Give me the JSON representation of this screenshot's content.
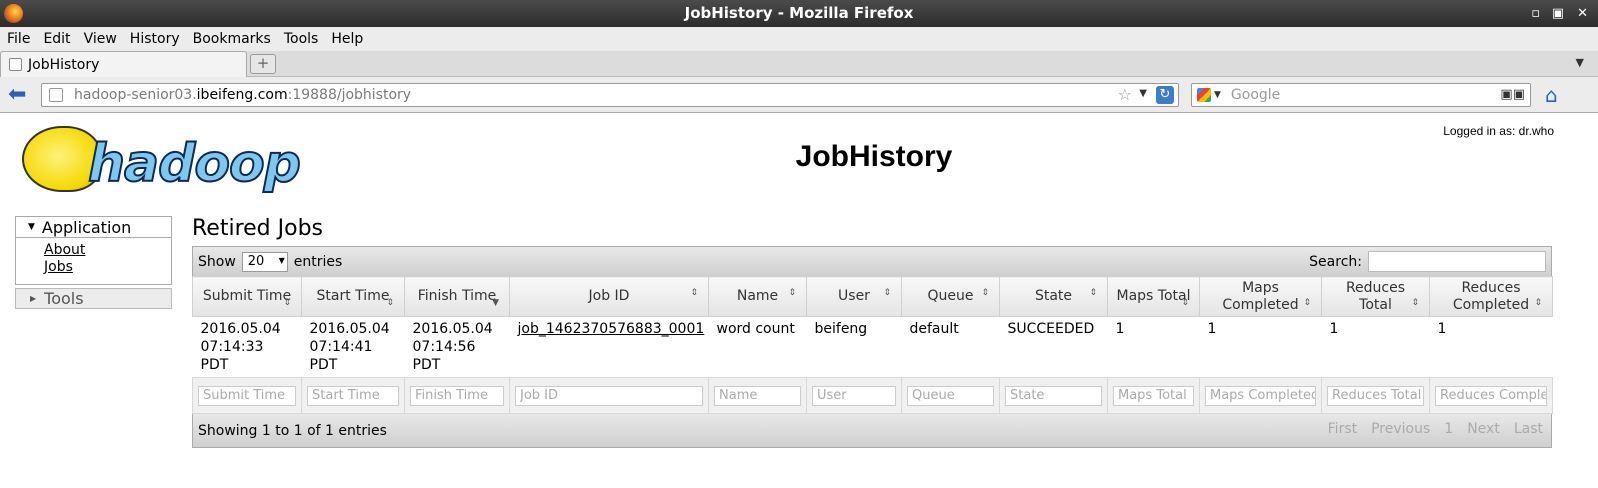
{
  "window": {
    "title": "JobHistory - Mozilla Firefox",
    "controls": [
      "▪",
      "▫",
      "✕"
    ]
  },
  "menu": [
    "File",
    "Edit",
    "View",
    "History",
    "Bookmarks",
    "Tools",
    "Help"
  ],
  "tab": {
    "label": "JobHistory"
  },
  "url": {
    "host_prefix": "hadoop-senior03.",
    "domain": "ibeifeng.com",
    "rest": ":19888/jobhistory"
  },
  "search": {
    "placeholder": "Google"
  },
  "page": {
    "title": "JobHistory",
    "logged_in": "Logged in as: dr.who",
    "logo_text": "hadoop",
    "heading": "Retired Jobs"
  },
  "sidebar": {
    "application_label": "Application",
    "links": [
      "About",
      "Jobs"
    ],
    "tools_label": "Tools"
  },
  "table": {
    "show_label": "Show",
    "entries_label": "entries",
    "page_size": "20",
    "search_label": "Search:",
    "columns": [
      "Submit Time",
      "Start Time",
      "Finish Time",
      "Job ID",
      "Name",
      "User",
      "Queue",
      "State",
      "Maps Total",
      "Maps Completed",
      "Reduces Total",
      "Reduces Completed"
    ],
    "rows": [
      [
        "2016.05.04 07:14:33 PDT",
        "2016.05.04 07:14:41 PDT",
        "2016.05.04 07:14:56 PDT",
        "job_1462370576883_0001",
        "word count",
        "beifeng",
        "default",
        "SUCCEEDED",
        "1",
        "1",
        "1",
        "1"
      ]
    ],
    "filters": [
      "Submit Time",
      "Start Time",
      "Finish Time",
      "Job ID",
      "Name",
      "User",
      "Queue",
      "State",
      "Maps Total",
      "Maps Completed",
      "Reduces Total",
      "Reduces Completed"
    ],
    "info": "Showing 1 to 1 of 1 entries",
    "pager": [
      "First",
      "Previous",
      "1",
      "Next",
      "Last"
    ]
  }
}
